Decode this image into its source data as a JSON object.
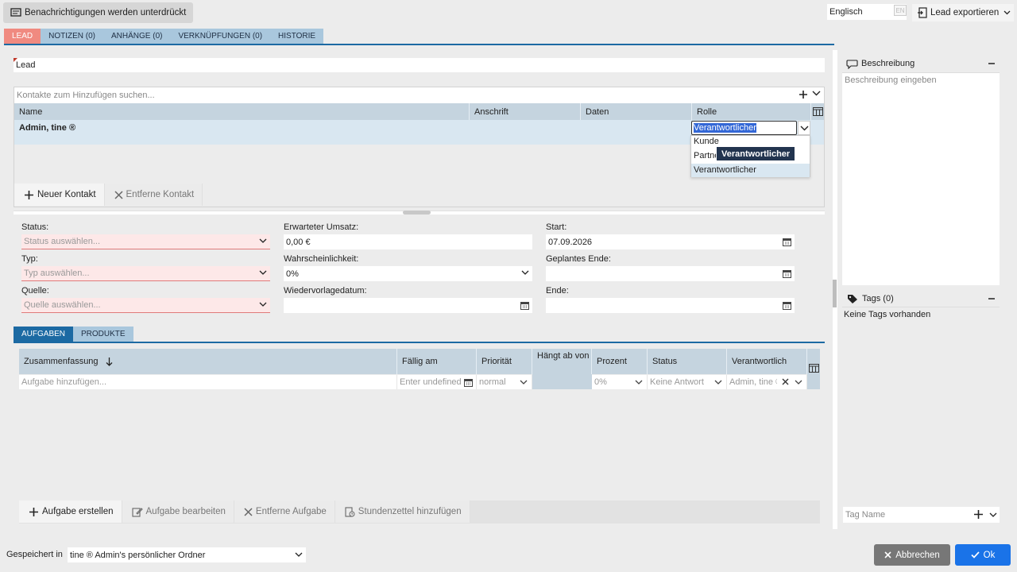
{
  "topbar": {
    "notifications_label": "Benachrichtigungen werden unterdrückt",
    "language_value": "Englisch",
    "language_badge": "EN",
    "export_label": "Lead exportieren"
  },
  "main_tabs": [
    {
      "label": "LEAD",
      "active": true
    },
    {
      "label": "NOTIZEN (0)",
      "active": false
    },
    {
      "label": "ANHÄNGE (0)",
      "active": false
    },
    {
      "label": "VERKNÜPFUNGEN (0)",
      "active": false
    },
    {
      "label": "HISTORIE",
      "active": false
    }
  ],
  "lead": {
    "title_value": "Lead"
  },
  "contacts": {
    "search_placeholder": "Kontakte zum Hinzufügen suchen...",
    "columns": [
      "Name",
      "Anschrift",
      "Daten",
      "Rolle"
    ],
    "rows": [
      {
        "name": "Admin, tine ®",
        "role": "Verantwortlicher"
      }
    ],
    "role_options": [
      "Kunde",
      "Partner",
      "Verantwortlicher"
    ],
    "role_option_1_partial": "Partne",
    "tooltip": "Verantwortlicher",
    "new_contact_label": "Neuer Kontakt",
    "remove_contact_label": "Entferne Kontakt"
  },
  "form": {
    "status_label": "Status:",
    "status_placeholder": "Status auswählen...",
    "type_label": "Typ:",
    "type_placeholder": "Typ auswählen...",
    "source_label": "Quelle:",
    "source_placeholder": "Quelle auswählen...",
    "revenue_label": "Erwarteter Umsatz:",
    "revenue_value": "0,00 €",
    "probability_label": "Wahrscheinlichkeit:",
    "probability_value": "0%",
    "resubmission_label": "Wiedervorlagedatum:",
    "resubmission_value": "",
    "start_label": "Start:",
    "start_value": "07.09.2026",
    "planned_end_label": "Geplantes Ende:",
    "planned_end_value": "",
    "end_label": "Ende:",
    "end_value": ""
  },
  "sub_tabs": [
    {
      "label": "AUFGABEN",
      "active": true
    },
    {
      "label": "PRODUKTE",
      "active": false
    }
  ],
  "tasks": {
    "columns": {
      "summary": "Zusammenfassung",
      "due": "Fällig am",
      "priority": "Priorität",
      "depends": "Hängt ab von",
      "percent": "Prozent",
      "status": "Status",
      "responsible": "Verantwortlich"
    },
    "new_row": {
      "summary_placeholder": "Aufgabe hinzufügen...",
      "due_placeholder": "Enter undefined",
      "priority": "normal",
      "percent": "0%",
      "status": "Keine Antwort",
      "responsible": "Admin, tine ®"
    },
    "toolbar": {
      "create": "Aufgabe erstellen",
      "edit": "Aufgabe bearbeiten",
      "remove": "Entferne Aufgabe",
      "timesheet": "Stundenzettel hinzufügen"
    }
  },
  "side": {
    "description_title": "Beschreibung",
    "description_placeholder": "Beschreibung eingeben",
    "tags_title": "Tags (0)",
    "tags_empty": "Keine Tags vorhanden",
    "tag_placeholder": "Tag Name"
  },
  "footer": {
    "saved_in_label": "Gespeichert in",
    "folder_value": "tine ® Admin's persönlicher Ordner",
    "cancel_label": "Abbrechen",
    "ok_label": "Ok"
  },
  "colors": {
    "accent": "#1c6aa3",
    "active_tab": "#f08a80",
    "ok_button": "#1a73e8",
    "required_bg": "#fde8e8"
  }
}
